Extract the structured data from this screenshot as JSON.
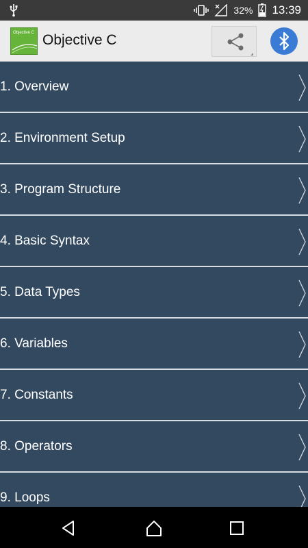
{
  "status_bar": {
    "battery_percent": "32%",
    "time": "13:39",
    "icons": [
      "usb-icon",
      "vibrate-icon",
      "no-signal-icon",
      "battery-icon"
    ]
  },
  "app_bar": {
    "logo_text": "Objective C",
    "title": "Objective C",
    "actions": [
      "share-icon",
      "bluetooth-icon"
    ]
  },
  "list": {
    "items": [
      {
        "label": "1. Overview"
      },
      {
        "label": "2. Environment Setup"
      },
      {
        "label": "3. Program Structure"
      },
      {
        "label": "4. Basic Syntax"
      },
      {
        "label": "5. Data Types"
      },
      {
        "label": "6. Variables"
      },
      {
        "label": "7. Constants"
      },
      {
        "label": "8. Operators"
      },
      {
        "label": "9. Loops"
      }
    ]
  },
  "nav_bar": {
    "buttons": [
      "back-icon",
      "home-icon",
      "recents-icon"
    ]
  },
  "colors": {
    "list_bg": "#334960",
    "app_bar_bg": "#ececec",
    "accent_bluetooth": "#3a7bd5",
    "logo_green": "#67b43a"
  }
}
